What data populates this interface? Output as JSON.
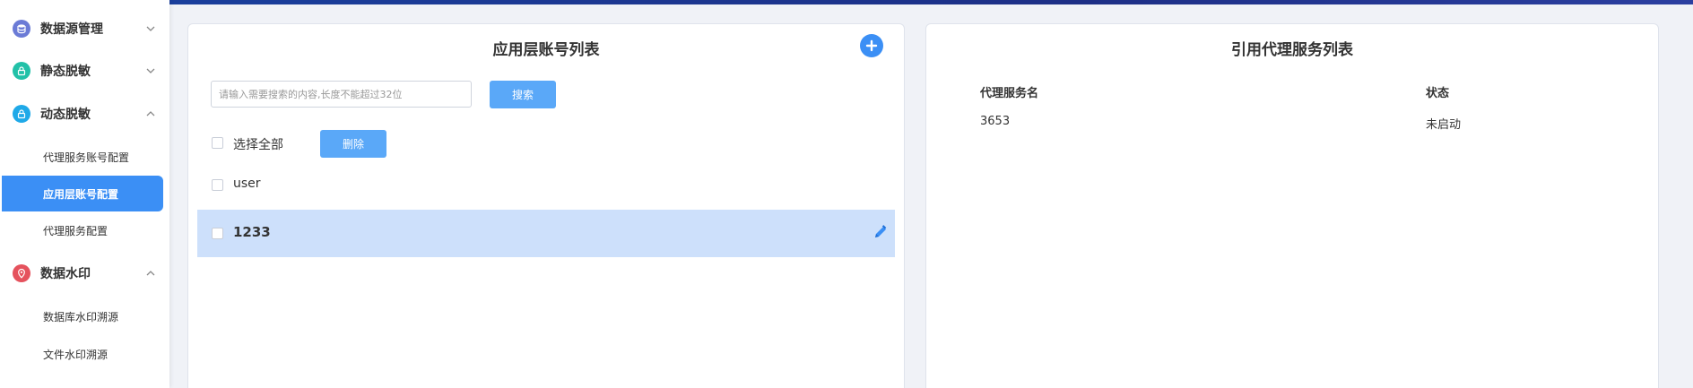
{
  "colors": {
    "primary": "#3b8ff5",
    "button": "#5aa8f8",
    "selected_row": "#cde0fb",
    "icon_datasource": "#6b7bd6",
    "icon_static": "#22c1a8",
    "icon_dynamic": "#1fa9e8",
    "icon_watermark": "#e5525d"
  },
  "sidebar": {
    "groups": [
      {
        "label": "数据源管理",
        "icon": "database-icon",
        "expanded": false
      },
      {
        "label": "静态脱敏",
        "icon": "lock-icon",
        "expanded": false
      },
      {
        "label": "动态脱敏",
        "icon": "lock-icon",
        "expanded": true
      },
      {
        "label": "数据水印",
        "icon": "location-pin-icon",
        "expanded": true
      }
    ],
    "dynamic_items": [
      {
        "label": "代理服务账号配置"
      },
      {
        "label": "应用层账号配置",
        "active": true
      },
      {
        "label": "代理服务配置"
      }
    ],
    "watermark_items": [
      {
        "label": "数据库水印溯源"
      },
      {
        "label": "文件水印溯源"
      }
    ]
  },
  "left_panel": {
    "title": "应用层账号列表",
    "search_placeholder": "请输入需要搜索的内容,长度不能超过32位",
    "search_button": "搜索",
    "select_all_label": "选择全部",
    "delete_button": "删除",
    "rows": [
      {
        "name": "user",
        "selected": false
      },
      {
        "name": "1233",
        "selected": true
      }
    ]
  },
  "right_panel": {
    "title": "引用代理服务列表",
    "columns": [
      "代理服务名",
      "状态"
    ],
    "rows": [
      {
        "name": "3653",
        "status": "未启动"
      }
    ]
  }
}
